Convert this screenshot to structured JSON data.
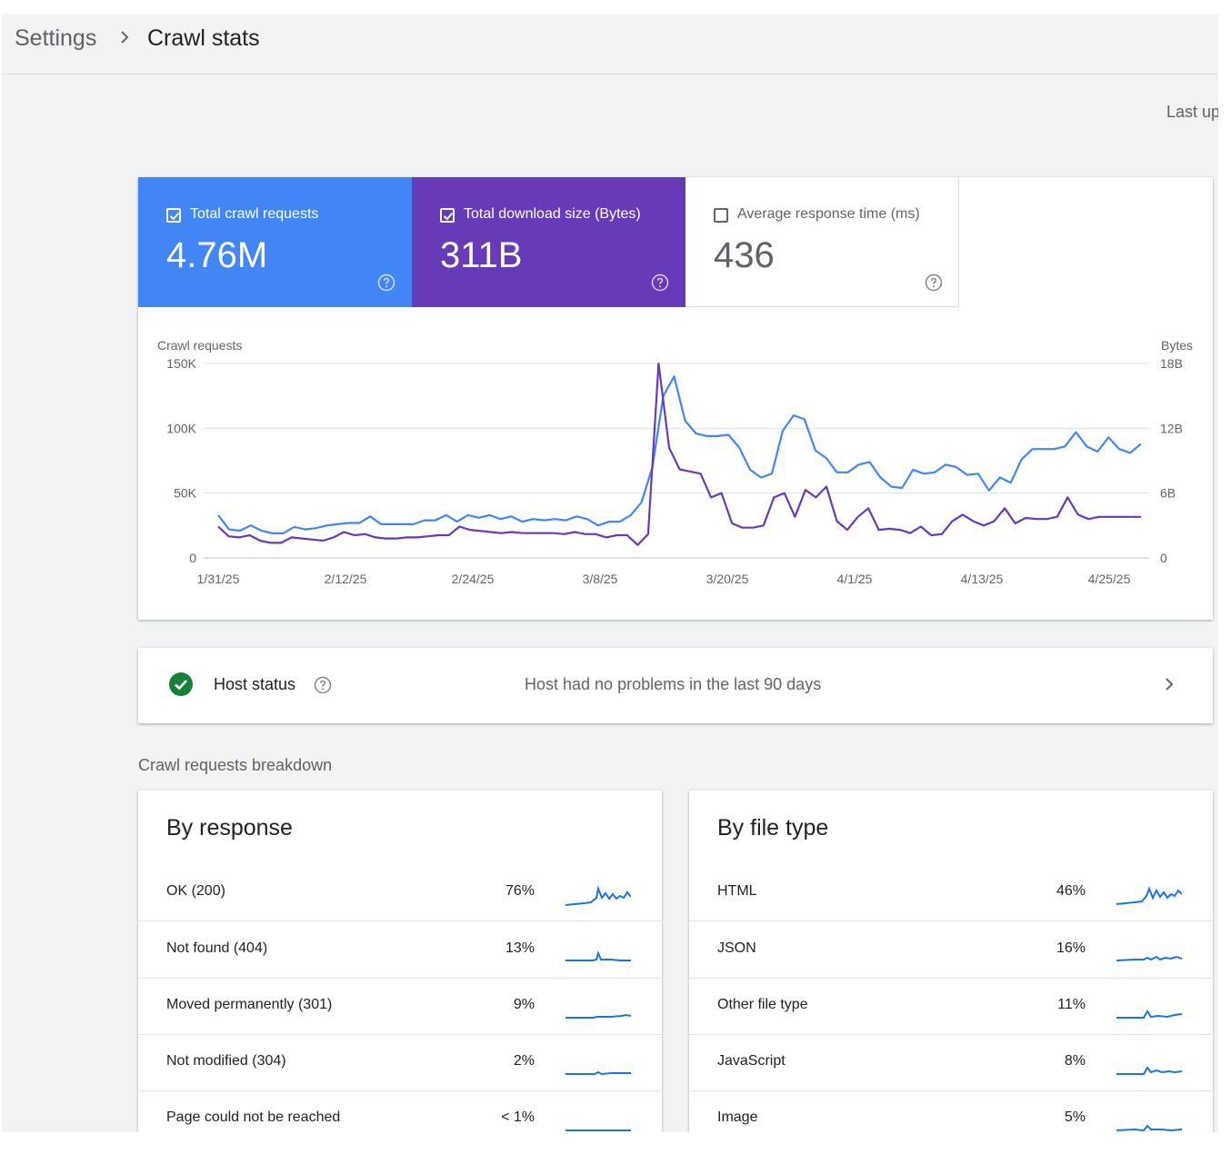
{
  "breadcrumb": {
    "parent": "Settings",
    "current": "Crawl stats"
  },
  "last_updated": "Last up",
  "metrics": [
    {
      "label": "Total crawl requests",
      "value": "4.76M",
      "checked": true,
      "color": "#4285f4"
    },
    {
      "label": "Total download size (Bytes)",
      "value": "311B",
      "checked": true,
      "color": "#673ab7"
    },
    {
      "label": "Average response time (ms)",
      "value": "436",
      "checked": false,
      "color": "#ffffff"
    }
  ],
  "chart_data": {
    "type": "line",
    "left_axis_label": "Crawl requests",
    "right_axis_label": "Bytes",
    "y_ticks_left": [
      "150K",
      "100K",
      "50K",
      "0"
    ],
    "y_ticks_right": [
      "18B",
      "12B",
      "6B",
      "0"
    ],
    "ylim_left": [
      0,
      150000
    ],
    "ylim_right": [
      0,
      18
    ],
    "x_tick_labels": [
      "1/31/25",
      "2/12/25",
      "2/24/25",
      "3/8/25",
      "3/20/25",
      "4/1/25",
      "4/13/25",
      "4/25/25"
    ],
    "grid": true,
    "series": [
      {
        "name": "Total crawl requests",
        "axis": "left",
        "color": "#4285f4",
        "values": [
          33000,
          22000,
          21000,
          25000,
          21000,
          19000,
          19000,
          24000,
          22000,
          23000,
          25000,
          26000,
          27000,
          27000,
          32000,
          26000,
          26000,
          26000,
          26000,
          29000,
          29000,
          33000,
          28000,
          33000,
          31000,
          33000,
          30000,
          32000,
          28000,
          30000,
          29000,
          30000,
          29000,
          32000,
          30000,
          25000,
          28000,
          28000,
          33000,
          43000,
          70000,
          125000,
          140000,
          106000,
          96000,
          94000,
          94000,
          95000,
          85000,
          68000,
          62000,
          65000,
          98000,
          110000,
          107000,
          83000,
          77000,
          66000,
          66000,
          72000,
          74000,
          62000,
          55000,
          54000,
          68000,
          65000,
          66000,
          72000,
          70000,
          64000,
          65000,
          52000,
          62000,
          58000,
          76000,
          84000,
          84000,
          84000,
          86000,
          97000,
          86000,
          82000,
          93000,
          84000,
          81000,
          88000
        ]
      },
      {
        "name": "Total download size (Bytes)",
        "axis": "right",
        "color": "#673ab7",
        "values": [
          2.9,
          2.0,
          1.9,
          2.1,
          1.6,
          1.4,
          1.4,
          1.9,
          1.8,
          1.7,
          1.6,
          1.9,
          2.4,
          2.1,
          2.2,
          1.9,
          1.8,
          1.8,
          1.9,
          1.9,
          2.0,
          2.1,
          2.1,
          2.9,
          2.6,
          2.5,
          2.4,
          2.3,
          2.4,
          2.3,
          2.3,
          2.3,
          2.3,
          2.2,
          2.4,
          2.2,
          2.2,
          1.9,
          2.1,
          2.1,
          1.2,
          2.2,
          18.0,
          10.2,
          8.2,
          8.0,
          7.8,
          5.6,
          6.0,
          3.2,
          2.8,
          2.8,
          3.0,
          5.6,
          6.0,
          3.8,
          6.3,
          5.6,
          6.6,
          3.4,
          2.6,
          3.8,
          4.6,
          2.6,
          2.7,
          2.6,
          2.3,
          2.9,
          2.1,
          2.2,
          3.4,
          4.0,
          3.4,
          3.0,
          3.4,
          4.6,
          3.2,
          3.7,
          3.6,
          3.6,
          3.8,
          5.6,
          4.0,
          3.6,
          3.8,
          3.8,
          3.8,
          3.8,
          3.8
        ]
      }
    ]
  },
  "host_status": {
    "label": "Host status",
    "message": "Host had no problems in the last 90 days",
    "status_color": "#188038"
  },
  "breakdown": {
    "section_title": "Crawl requests breakdown",
    "by_response": {
      "title": "By response",
      "rows": [
        {
          "label": "OK (200)",
          "pct": "76%"
        },
        {
          "label": "Not found (404)",
          "pct": "13%"
        },
        {
          "label": "Moved permanently (301)",
          "pct": "9%"
        },
        {
          "label": "Not modified (304)",
          "pct": "2%"
        },
        {
          "label": "Page could not be reached",
          "pct": "< 1%"
        }
      ]
    },
    "by_file_type": {
      "title": "By file type",
      "rows": [
        {
          "label": "HTML",
          "pct": "46%"
        },
        {
          "label": "JSON",
          "pct": "16%"
        },
        {
          "label": "Other file type",
          "pct": "11%"
        },
        {
          "label": "JavaScript",
          "pct": "8%"
        },
        {
          "label": "Image",
          "pct": "5%"
        }
      ]
    },
    "spark_color": "#1a73e8"
  }
}
